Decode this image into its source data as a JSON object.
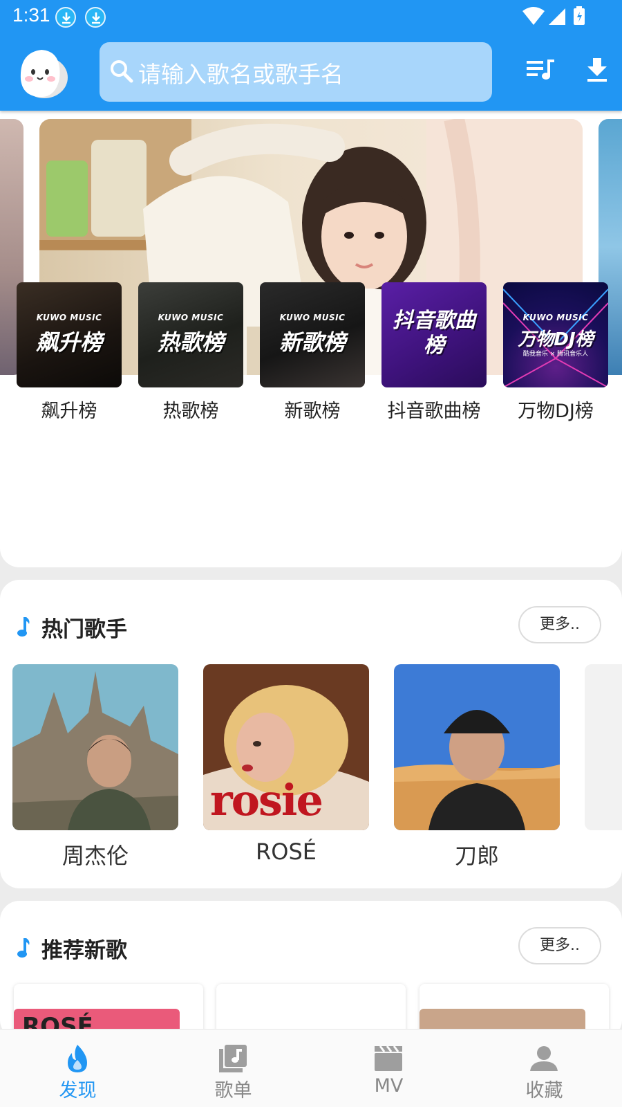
{
  "status_bar": {
    "time": "1:31"
  },
  "header": {
    "search_placeholder": "请输入歌名或歌手名"
  },
  "banner": {
    "dot_count": 2,
    "active_dot": 1
  },
  "charts": [
    {
      "label": "飙升榜",
      "cover_brand": "KUWO MUSIC",
      "cover_title": "飙升榜"
    },
    {
      "label": "热歌榜",
      "cover_brand": "KUWO MUSIC",
      "cover_title": "热歌榜"
    },
    {
      "label": "新歌榜",
      "cover_brand": "KUWO MUSIC",
      "cover_title": "新歌榜"
    },
    {
      "label": "抖音歌曲榜",
      "cover_brand": "",
      "cover_title": "抖音歌曲榜"
    },
    {
      "label": "万物DJ榜",
      "cover_brand": "KUWO MUSIC",
      "cover_title": "万物DJ榜",
      "cover_subtitle": "酷我音乐 × 腾讯音乐人"
    }
  ],
  "hot_singers": {
    "title": "热门歌手",
    "more_label": "更多..",
    "items": [
      {
        "name": "周杰伦"
      },
      {
        "name": "ROSÉ",
        "photo_text": "rosie"
      },
      {
        "name": "刀郎"
      }
    ]
  },
  "new_songs": {
    "title": "推荐新歌",
    "more_label": "更多..",
    "first_card_text": "ROSÉ"
  },
  "bottom_nav": [
    {
      "label": "发现",
      "icon": "flame-icon",
      "active": true
    },
    {
      "label": "歌单",
      "icon": "music-album-icon",
      "active": false
    },
    {
      "label": "MV",
      "icon": "clapperboard-icon",
      "active": false
    },
    {
      "label": "收藏",
      "icon": "person-icon",
      "active": false
    }
  ],
  "colors": {
    "primary": "#2196f3",
    "search_bg": "#a8d6fb",
    "page_bg": "#ececec"
  }
}
